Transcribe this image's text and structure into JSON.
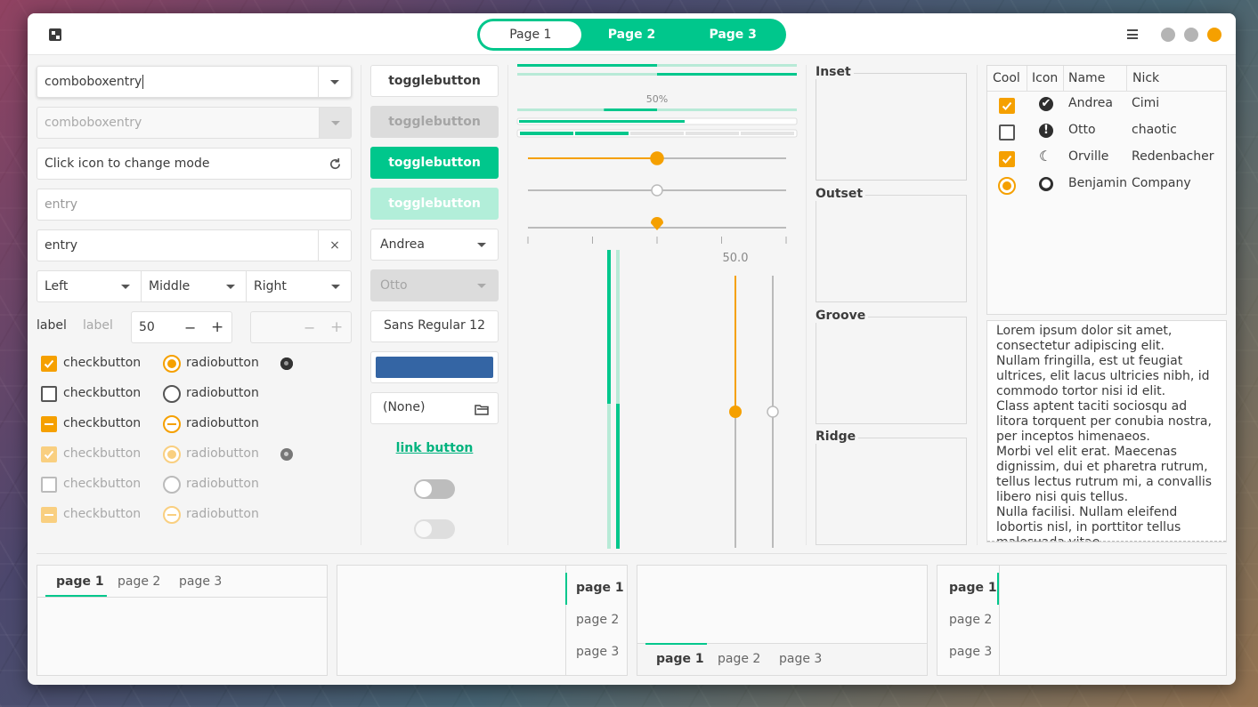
{
  "header": {
    "tabs": [
      {
        "label": "Page 1",
        "active": true
      },
      {
        "label": "Page 2",
        "active": false
      },
      {
        "label": "Page 3",
        "active": false
      }
    ],
    "window_buttons": {
      "minimize": "#b4b4b4",
      "maximize": "#b4b4b4",
      "close": "#f5a000"
    }
  },
  "left": {
    "combo_entry_1": "comboboxentry",
    "combo_entry_2": "comboboxentry",
    "icon_entry": "Click icon to change mode",
    "entry_placeholder": "entry",
    "entry_value": "entry",
    "clear_glyph": "×",
    "combos": [
      "Left",
      "Middle",
      "Right"
    ],
    "label1": "label",
    "label2": "label",
    "spin_value": "50",
    "minus": "−",
    "plus": "+",
    "checks": [
      {
        "label": "checkbutton",
        "state": "checked",
        "dim": false
      },
      {
        "label": "checkbutton",
        "state": "unchecked",
        "dim": false
      },
      {
        "label": "checkbutton",
        "state": "mixed",
        "dim": false
      },
      {
        "label": "checkbutton",
        "state": "checked",
        "dim": true
      },
      {
        "label": "checkbutton",
        "state": "unchecked",
        "dim": true
      },
      {
        "label": "checkbutton",
        "state": "mixed",
        "dim": true
      }
    ],
    "radios": [
      {
        "label": "radiobutton",
        "state": "checked",
        "dim": false
      },
      {
        "label": "radiobutton",
        "state": "unchecked",
        "dim": false
      },
      {
        "label": "radiobutton",
        "state": "mixed",
        "dim": false
      },
      {
        "label": "radiobutton",
        "state": "checked",
        "dim": true
      },
      {
        "label": "radiobutton",
        "state": "unchecked",
        "dim": true
      },
      {
        "label": "radiobutton",
        "state": "mixed",
        "dim": true
      }
    ]
  },
  "buttons": {
    "toggle": [
      "togglebutton",
      "togglebutton",
      "togglebutton",
      "togglebutton"
    ],
    "combo1": "Andrea",
    "combo2": "Otto",
    "font_name": "Sans Regular",
    "font_size": "12",
    "color_swatch": "#3465a4",
    "file_chooser": "(None)",
    "link": "link button",
    "switch1_on": false,
    "switch2_on": false
  },
  "progress": {
    "label": "50%",
    "fraction": 0.5,
    "scale1": 0.5,
    "scale2": 0.5,
    "scale3": 0.5,
    "vscale_label": "50.0",
    "vscale1": 0.5,
    "vscale2": 0.5
  },
  "frames": [
    "Inset",
    "Outset",
    "Groove",
    "Ridge"
  ],
  "tree": {
    "headers": [
      "Cool",
      "Icon",
      "Name",
      "Nick"
    ],
    "rows": [
      {
        "cool": "checked",
        "icon": "check-circle-icon",
        "glyph": "✔",
        "name": "Andrea",
        "nick": "Cimi"
      },
      {
        "cool": "unchecked",
        "icon": "alert-icon",
        "glyph": "!",
        "name": "Otto",
        "nick": "chaotic"
      },
      {
        "cool": "checked",
        "icon": "moon-icon",
        "glyph": "☾",
        "name": "Orville",
        "nick": "Redenbacher"
      },
      {
        "cool": "radio",
        "icon": "person-icon",
        "glyph": "●",
        "name": "Benjamin",
        "nick": "Company"
      }
    ]
  },
  "text": {
    "paragraphs": [
      "Lorem ipsum dolor sit amet, consectetur adipiscing elit.",
      "Nullam fringilla, est ut feugiat ultrices, elit lacus ultricies nibh, id commodo tortor nisi id elit.",
      "Class aptent taciti sociosqu ad litora torquent per conubia nostra, per inceptos himenaeos.",
      "Morbi vel elit erat. Maecenas dignissim, dui et pharetra rutrum, tellus lectus rutrum mi, a convallis libero nisi quis tellus.",
      "Nulla facilisi. Nullam eleifend lobortis nisl, in porttitor tellus malesuada vitae."
    ]
  },
  "notebooks": [
    {
      "tabs": [
        "page 1",
        "page 2",
        "page 3"
      ]
    },
    {
      "tabs": [
        "page 1",
        "page 2",
        "page 3"
      ]
    },
    {
      "tabs": [
        "page 1",
        "page 2",
        "page 3"
      ]
    },
    {
      "tabs": [
        "page 1",
        "page 2",
        "page 3"
      ]
    }
  ],
  "colors": {
    "accent": "#00c78c",
    "orange": "#f5a000"
  }
}
